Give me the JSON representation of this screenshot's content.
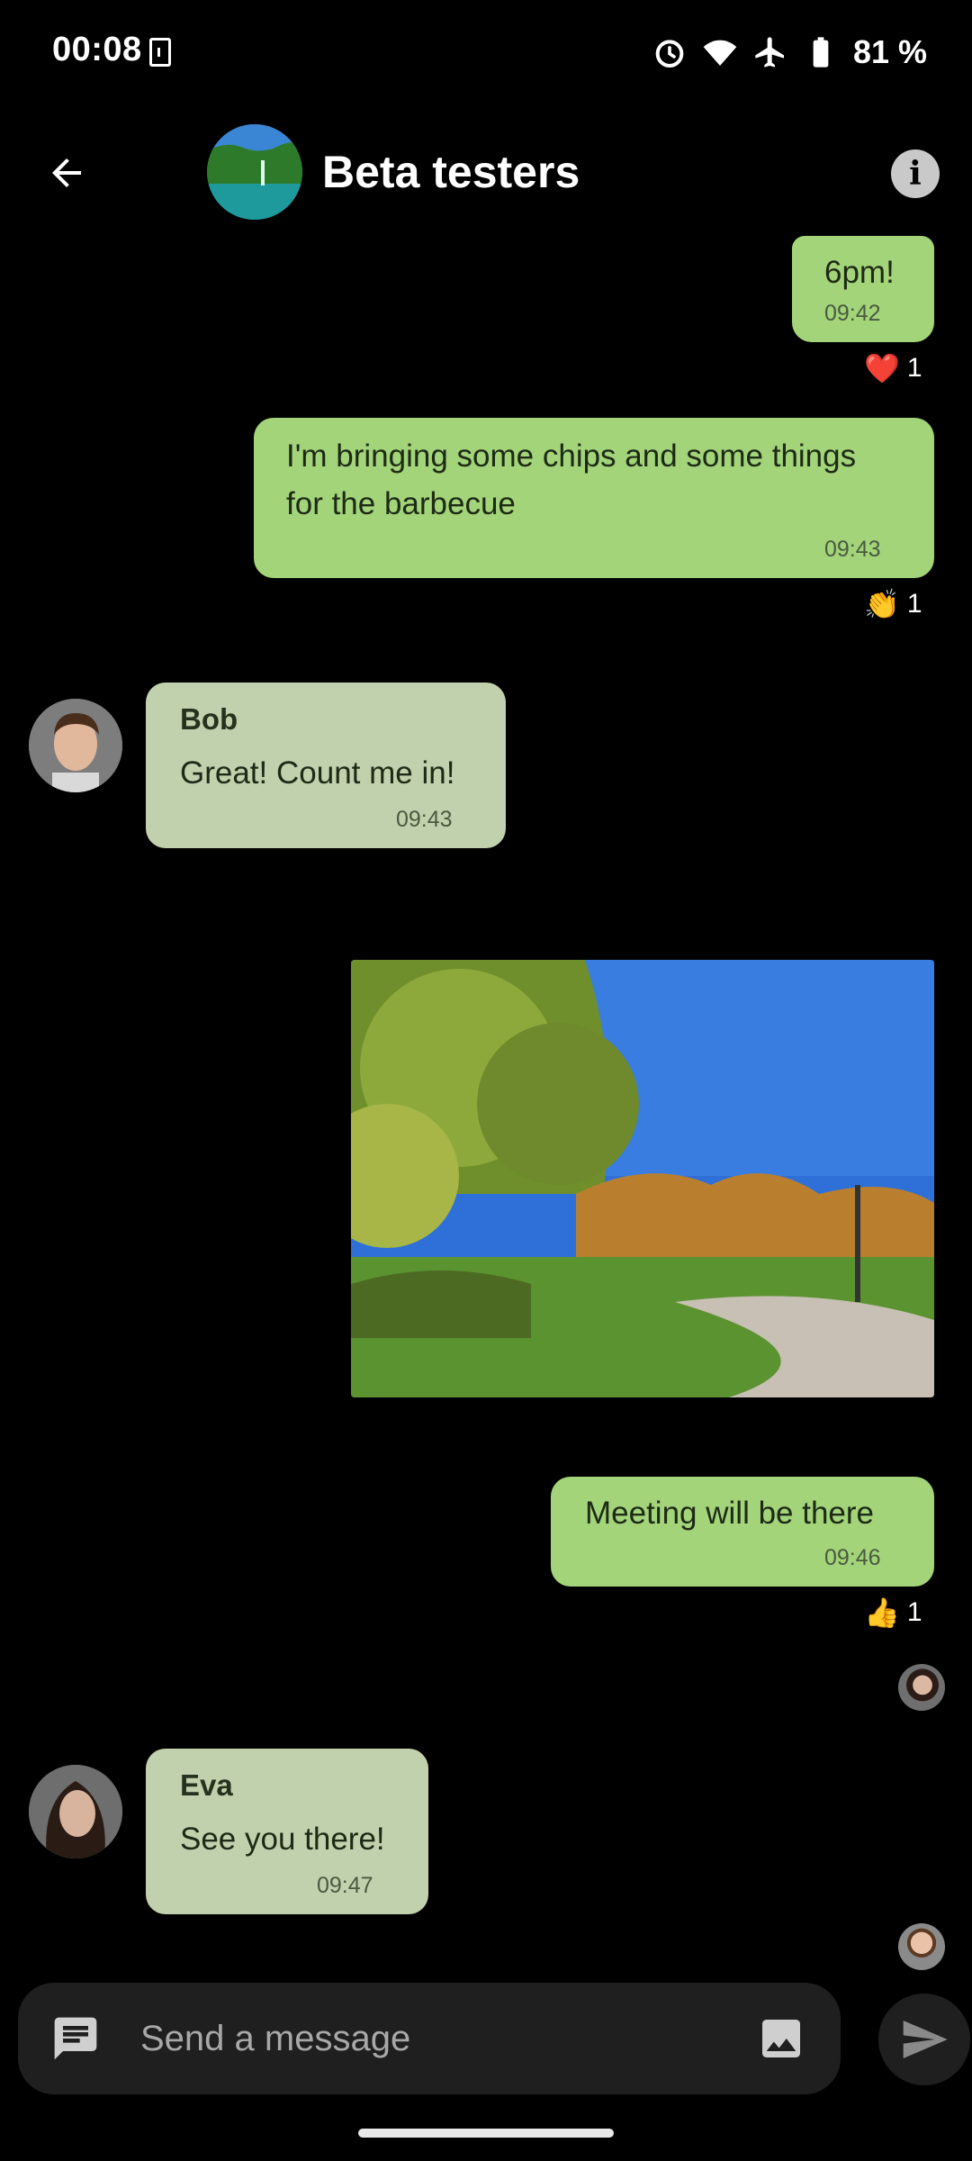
{
  "status_bar": {
    "time": "00:08",
    "battery_pct": "81 %",
    "icons": [
      "sim-card-icon",
      "alarm-icon",
      "wifi-icon",
      "airplane-icon",
      "battery-icon"
    ]
  },
  "header": {
    "title": "Beta testers",
    "back_icon": "arrow-left-icon",
    "info_icon": "info-icon",
    "info_glyph": "i"
  },
  "messages": [
    {
      "direction": "outgoing",
      "text": "6pm!",
      "time": "09:42",
      "reaction": {
        "emoji": "❤️",
        "count": "1"
      }
    },
    {
      "direction": "outgoing",
      "text": "I'm bringing some chips and some things for the barbecue",
      "time": "09:43",
      "reaction": {
        "emoji": "👏",
        "count": "1"
      }
    },
    {
      "direction": "incoming",
      "sender": "Bob",
      "text": "Great! Count me in!",
      "time": "09:43"
    },
    {
      "direction": "outgoing",
      "type": "image",
      "alt": "park photo"
    },
    {
      "direction": "outgoing",
      "text": "Meeting will be there",
      "time": "09:46",
      "reaction": {
        "emoji": "👍",
        "count": "1"
      }
    },
    {
      "direction": "incoming",
      "sender": "Eva",
      "text": "See you there!",
      "time": "09:47"
    }
  ],
  "composer": {
    "placeholder": "Send a message",
    "left_icon": "message-icon",
    "right_icon": "image-icon",
    "send_icon": "send-icon"
  },
  "colors": {
    "background": "#000000",
    "outgoing_bubble": "#a3d47a",
    "incoming_bubble": "#c2d1ad",
    "composer": "#1f1f1f"
  }
}
